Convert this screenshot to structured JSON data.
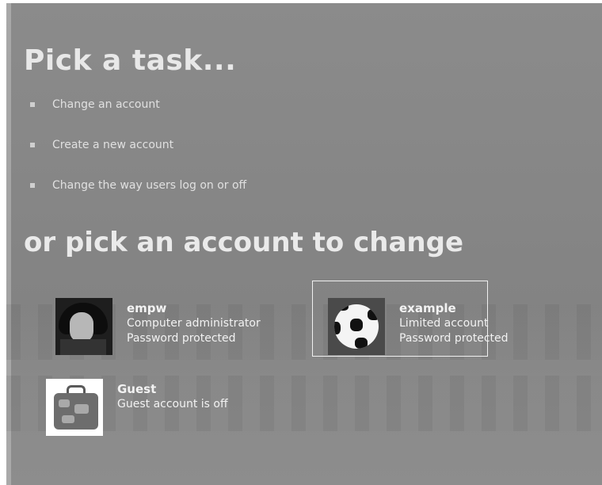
{
  "tasks": {
    "title": "Pick a task...",
    "items": [
      {
        "label": "Change an account"
      },
      {
        "label": "Create a new account"
      },
      {
        "label": "Change the way users log on or off"
      }
    ]
  },
  "accounts": {
    "title": "or pick an account to change",
    "list": [
      {
        "name": "empw",
        "line1": "Computer administrator",
        "line2": "Password protected",
        "picture": "portrait-picture"
      },
      {
        "name": "example",
        "line1": "Limited account",
        "line2": "Password protected",
        "picture": "soccer-ball-picture",
        "selected": true
      },
      {
        "name": "Guest",
        "line1": "Guest account is off",
        "line2": "",
        "picture": "suitcase-picture"
      }
    ]
  }
}
